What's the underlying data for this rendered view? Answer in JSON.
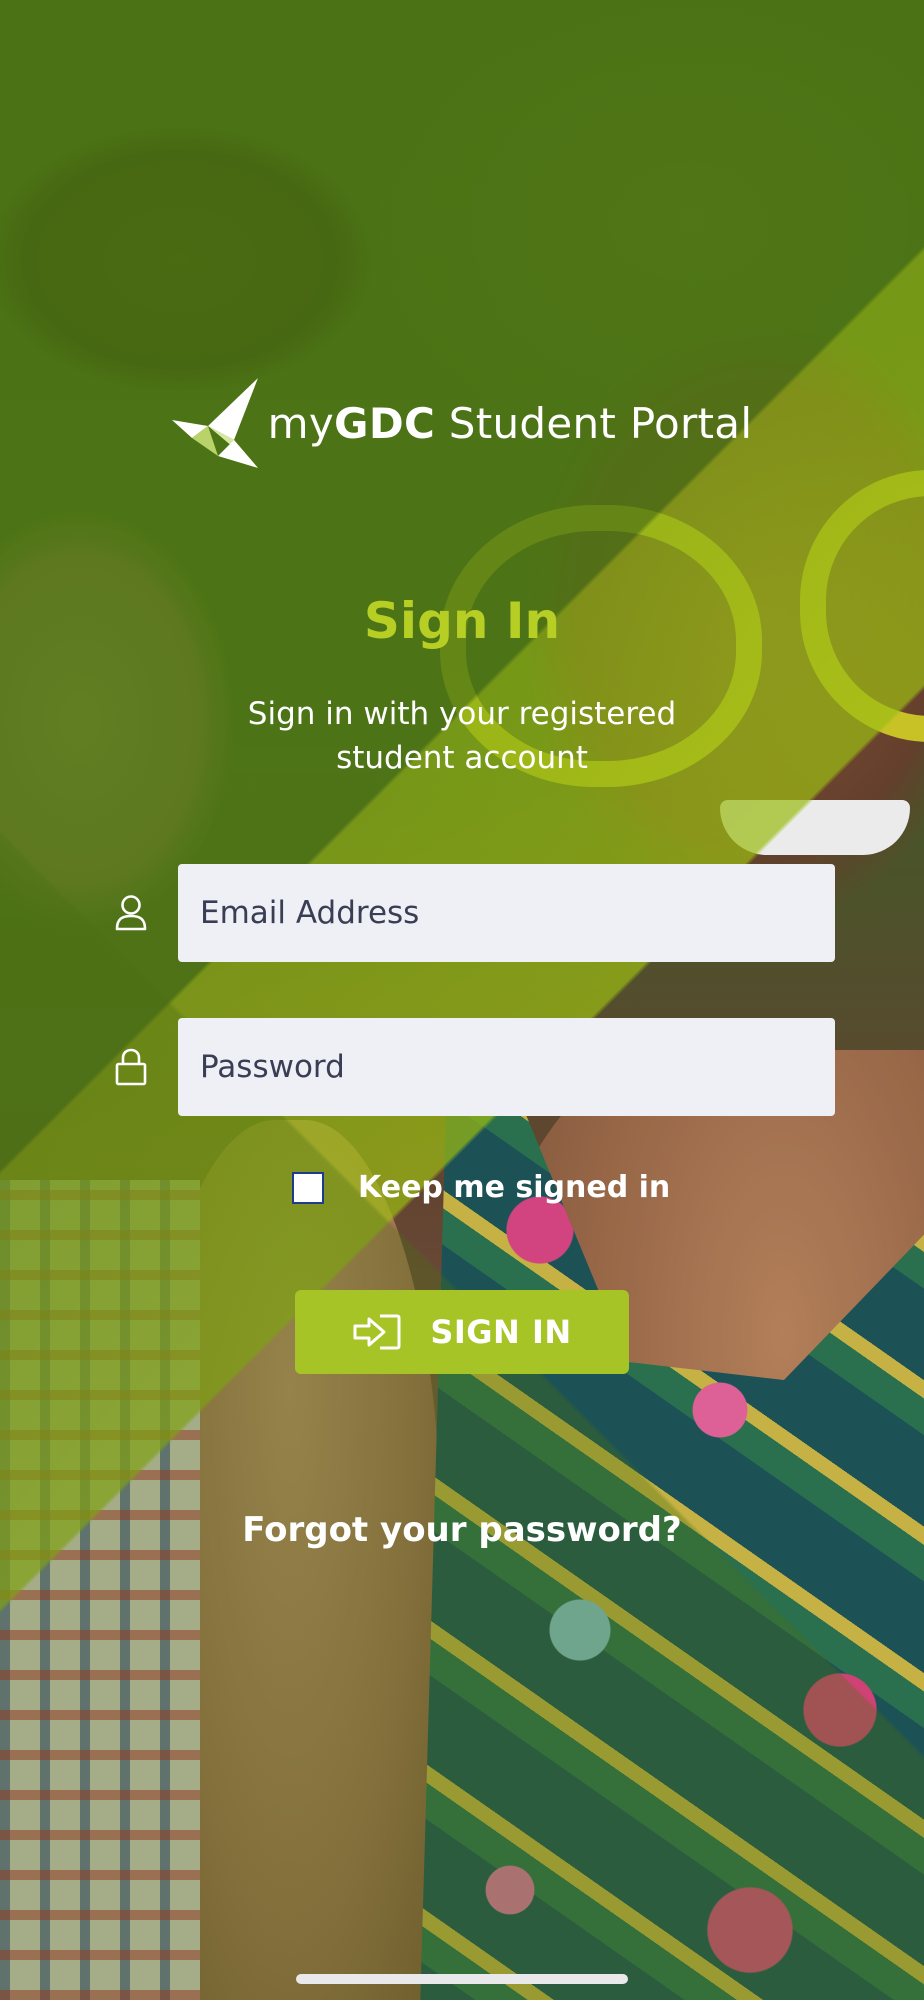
{
  "brand": {
    "prefix": "my",
    "bold": "GDC",
    "suffix": " Student Portal"
  },
  "signin": {
    "title": "Sign In",
    "subtitle_line1": "Sign in with your registered",
    "subtitle_line2": "student account"
  },
  "form": {
    "email": {
      "placeholder": "Email Address",
      "value": "",
      "icon": "user-icon"
    },
    "password": {
      "placeholder": "Password",
      "value": "",
      "icon": "lock-icon"
    },
    "keep_signed_in": {
      "label": "Keep me signed in",
      "checked": false
    },
    "submit": {
      "label": "SIGN IN",
      "icon": "sign-in-arrow-icon"
    }
  },
  "forgot_password": "Forgot your password?",
  "colors": {
    "accent": "#a6c426",
    "title": "#b7cf24",
    "field_bg": "#eef0f5",
    "field_text": "#3a3e55"
  }
}
